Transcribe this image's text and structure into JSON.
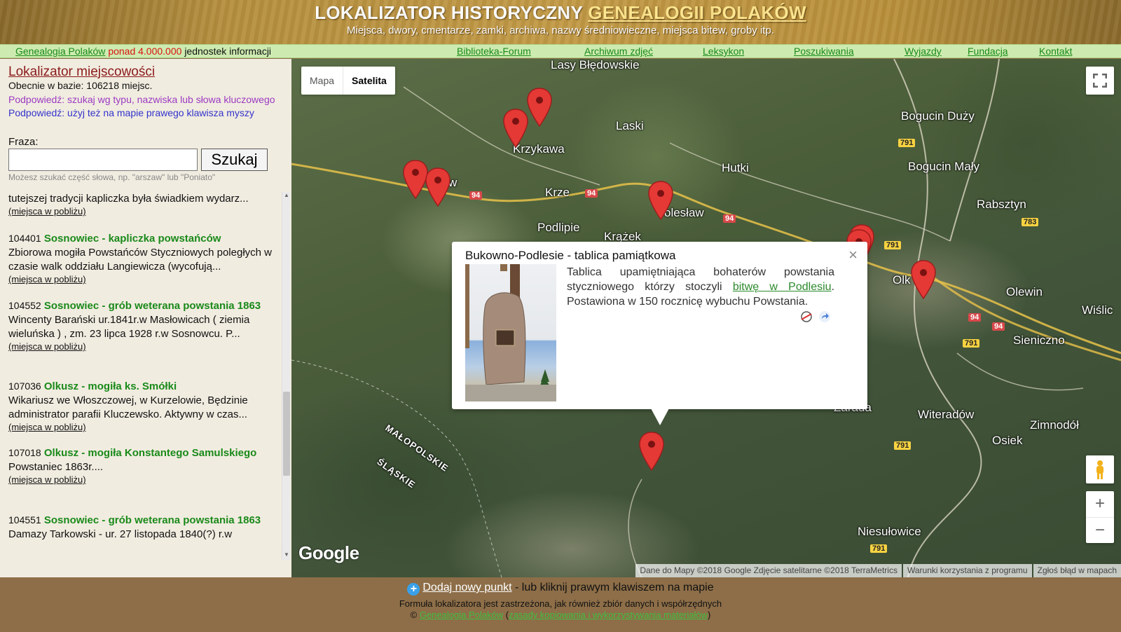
{
  "header": {
    "title_part1": "LOKALIZATOR HISTORYCZNY ",
    "title_part2": "GENEALOGII POLAKÓW",
    "subtitle": "Miejsca, dwory, cmentarze, zamki, archiwa, nazwy średniowieczne, miejsca bitew, groby itp."
  },
  "nav": {
    "brand": "Genealogia Polaków",
    "count": "ponad 4.000.000",
    "info_suffix": "jednostek informacji",
    "links": [
      "Biblioteka-Forum",
      "Archiwum zdjęć",
      "Leksykon",
      "Poszukiwania",
      "Wyjazdy",
      "Fundacja",
      "Kontakt"
    ]
  },
  "sidebar": {
    "title": "Lokalizator miejscowości",
    "count_line": "Obecnie w bazie: 106218 miejsc.",
    "hint1": "Podpowiedź: szukaj wg typu, nazwiska lub słowa kluczowego",
    "hint2": "Podpowiedź: użyj też na mapie prawego klawisza myszy",
    "fraza_label": "Fraza:",
    "search_value": "",
    "search_button": "Szukaj",
    "search_help": "Możesz szukać część słowa, np. \"arszaw\" lub \"Poniato\"",
    "results": [
      {
        "num": "",
        "title": "",
        "desc": "tutejszej tradycji kapliczka była świadkiem wydarz...",
        "near": "(miejsca w pobliżu)"
      },
      {
        "num": "104401",
        "title": "Sosnowiec - kapliczka powstańców",
        "desc": "Zbiorowa mogiła Powstańców Styczniowych poległych w czasie walk oddziału Langiewicza (wycofują...",
        "near": "(miejsca w pobliżu)"
      },
      {
        "num": "104552",
        "title": "Sosnowiec - grób weterana powstania 1863",
        "desc": "Wincenty Barański ur.1841r.w Masłowicach ( ziemia wieluńska ) , zm. 23 lipca 1928 r.w Sosnowcu. P...",
        "near": "(miejsca w pobliżu)"
      },
      {
        "num": "107036",
        "title": "Olkusz - mogiła ks. Smółki",
        "desc": "Wikariusz we Włoszczowej, w Kurzelowie, Będzinie administrator parafii Kluczewsko. Aktywny w czas...",
        "near": "(miejsca w pobliżu)"
      },
      {
        "num": "107018",
        "title": "Olkusz - mogiła Konstantego Samulskiego",
        "desc": "Powstaniec 1863r....",
        "near": "(miejsca w pobliżu)"
      },
      {
        "num": "104551",
        "title": "Sosnowiec - grób weterana powstania 1863",
        "desc": "Damazy Tarkowski - ur. 27 listopada 1840(?) r.w",
        "near": ""
      }
    ]
  },
  "map": {
    "type_buttons": [
      "Mapa",
      "Satelita"
    ],
    "active_type": "Satelita",
    "labels": [
      "Lasy Błędowskie",
      "Laski",
      "Krzykawa",
      "Hutki",
      "Bogucin Duży",
      "Bogucin Mały",
      "Rabsztyn",
      "Krze",
      "Podlipie",
      "Krążek",
      "olesław",
      "Olk",
      "Olewin",
      "Wiślic",
      "Sieniczno",
      "Zarada",
      "Witeradów",
      "Zimnodół",
      "Osiek",
      "Niesułowice",
      "MAŁOPOLSKIE",
      "ŚLĄSKIE",
      "w"
    ],
    "road_numbers": [
      "94",
      "94",
      "94",
      "94",
      "94",
      "791",
      "791",
      "783",
      "791",
      "791",
      "791",
      "791"
    ],
    "attribution": [
      "Dane do Mapy ©2018 Google Zdjęcie satelitarne ©2018 TerraMetrics",
      "Warunki korzystania z programu",
      "Zgłoś błąd w mapach"
    ],
    "logo": "Google",
    "zoom_in": "+",
    "zoom_out": "−"
  },
  "info_window": {
    "title": "Bukowno-Podlesie - tablica pamiątkowa",
    "text_before": "Tablica upamiętniająca bohaterów powstania styczniowego którzy stoczyli ",
    "link": "bitwę w Podlesiu",
    "text_after": ". Postawiona w 150 rocznicę wybuchu Powstania.",
    "close": "×"
  },
  "footer": {
    "add_link": "Dodaj nowy punkt",
    "add_suffix": " - lub kliknij prawym klawiszem na mapie",
    "line2": "Formuła lokalizatora jest zastrzeżona, jak również zbiór danych i współrzędnych",
    "copy": "©",
    "brand": "Genealogia Polaków",
    "rules": "zasady kopiowania i wykorzystywania materiałów",
    "paren_open": "(",
    "paren_close": ")"
  },
  "colors": {
    "header_gold": "#c29a46",
    "nav_green_bg": "#cdebb0",
    "link_green": "#1a8a1a",
    "marker_red": "#e53935",
    "footer_brown": "#8d6e48"
  }
}
